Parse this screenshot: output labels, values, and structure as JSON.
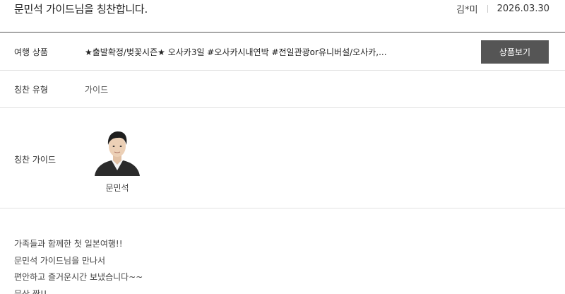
{
  "header": {
    "title": "문민석 가이드님을 칭찬합니다.",
    "author": "김*미",
    "date": "2026.03.30"
  },
  "product": {
    "label": "여행 상품",
    "value": "★출발확정/벚꽃시즌★ 오사카3일 #오사카시내연박 #전일관광or유니버설/오사카,...",
    "button_label": "상품보기"
  },
  "praise_type": {
    "label": "칭찬 유형",
    "value": "가이드"
  },
  "praise_guide": {
    "label": "칭찬 가이드",
    "guide_name": "문민석",
    "avatar_icon": "guide-portrait"
  },
  "review": {
    "lines": [
      "가족들과 함께한 첫 일본여행!!",
      "문민석 가이드님을 만나서",
      "편안하고 즐거운시간 보냈습니다~~",
      "문상 짱!!"
    ]
  }
}
